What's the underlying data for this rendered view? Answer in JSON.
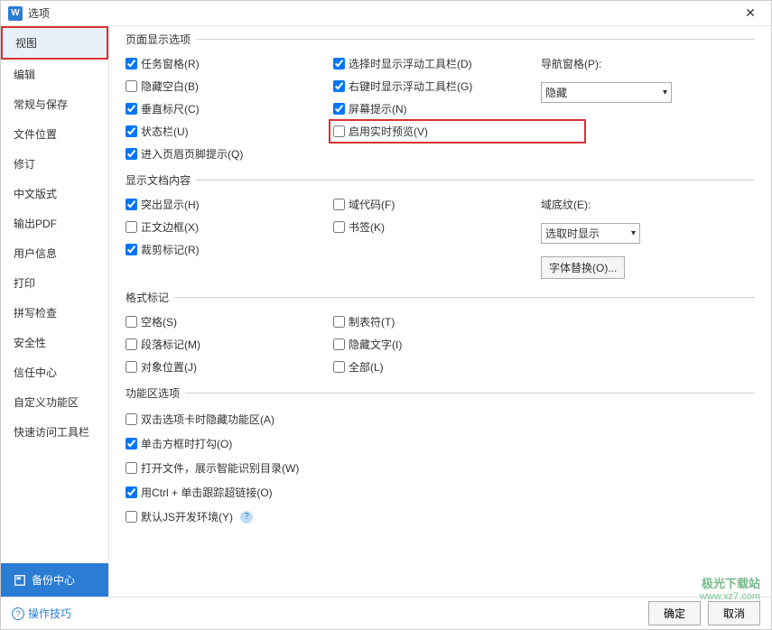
{
  "window": {
    "title": "选项"
  },
  "sidebar": {
    "items": [
      {
        "label": "视图",
        "active": true,
        "highlighted": true
      },
      {
        "label": "编辑"
      },
      {
        "label": "常规与保存"
      },
      {
        "label": "文件位置"
      },
      {
        "label": "修订"
      },
      {
        "label": "中文版式"
      },
      {
        "label": "输出PDF"
      },
      {
        "label": "用户信息"
      },
      {
        "label": "打印"
      },
      {
        "label": "拼写检查"
      },
      {
        "label": "安全性"
      },
      {
        "label": "信任中心"
      },
      {
        "label": "自定义功能区"
      },
      {
        "label": "快速访问工具栏"
      }
    ],
    "backup": "备份中心"
  },
  "sections": {
    "pageDisplay": {
      "legend": "页面显示选项",
      "col1": [
        {
          "label": "任务窗格(R)",
          "checked": true
        },
        {
          "label": "隐藏空白(B)",
          "checked": false
        },
        {
          "label": "垂直标尺(C)",
          "checked": true
        },
        {
          "label": "状态栏(U)",
          "checked": true
        },
        {
          "label": "进入页眉页脚提示(Q)",
          "checked": true
        }
      ],
      "col2": [
        {
          "label": "选择时显示浮动工具栏(D)",
          "checked": true
        },
        {
          "label": "右键时显示浮动工具栏(G)",
          "checked": true
        },
        {
          "label": "屏幕提示(N)",
          "checked": true
        },
        {
          "label": "启用实时预览(V)",
          "checked": false,
          "highlighted": true
        }
      ],
      "navPane": {
        "label": "导航窗格(P):",
        "value": "隐藏"
      }
    },
    "docContent": {
      "legend": "显示文档内容",
      "col1": [
        {
          "label": "突出显示(H)",
          "checked": true
        },
        {
          "label": "正文边框(X)",
          "checked": false
        },
        {
          "label": "裁剪标记(R)",
          "checked": true
        }
      ],
      "col2": [
        {
          "label": "域代码(F)",
          "checked": false
        },
        {
          "label": "书签(K)",
          "checked": false
        }
      ],
      "shading": {
        "label": "域底纹(E):",
        "value": "选取时显示"
      },
      "fontReplace": "字体替换(O)..."
    },
    "formatMarks": {
      "legend": "格式标记",
      "col1": [
        {
          "label": "空格(S)",
          "checked": false
        },
        {
          "label": "段落标记(M)",
          "checked": false
        },
        {
          "label": "对象位置(J)",
          "checked": false
        }
      ],
      "col2": [
        {
          "label": "制表符(T)",
          "checked": false
        },
        {
          "label": "隐藏文字(I)",
          "checked": false
        },
        {
          "label": "全部(L)",
          "checked": false
        }
      ]
    },
    "ribbon": {
      "legend": "功能区选项",
      "items": [
        {
          "label": "双击选项卡时隐藏功能区(A)",
          "checked": false
        },
        {
          "label": "单击方框时打勾(O)",
          "checked": true
        },
        {
          "label": "打开文件，展示智能识别目录(W)",
          "checked": false
        },
        {
          "label": "用Ctrl + 单击跟踪超链接(O)",
          "checked": true
        },
        {
          "label": "默认JS开发环境(Y)",
          "checked": false,
          "help": true
        }
      ]
    }
  },
  "footer": {
    "tips": "操作技巧",
    "ok": "确定",
    "cancel": "取消"
  },
  "watermark": {
    "l1": "极光下载站",
    "l2": "www.xz7.com"
  }
}
